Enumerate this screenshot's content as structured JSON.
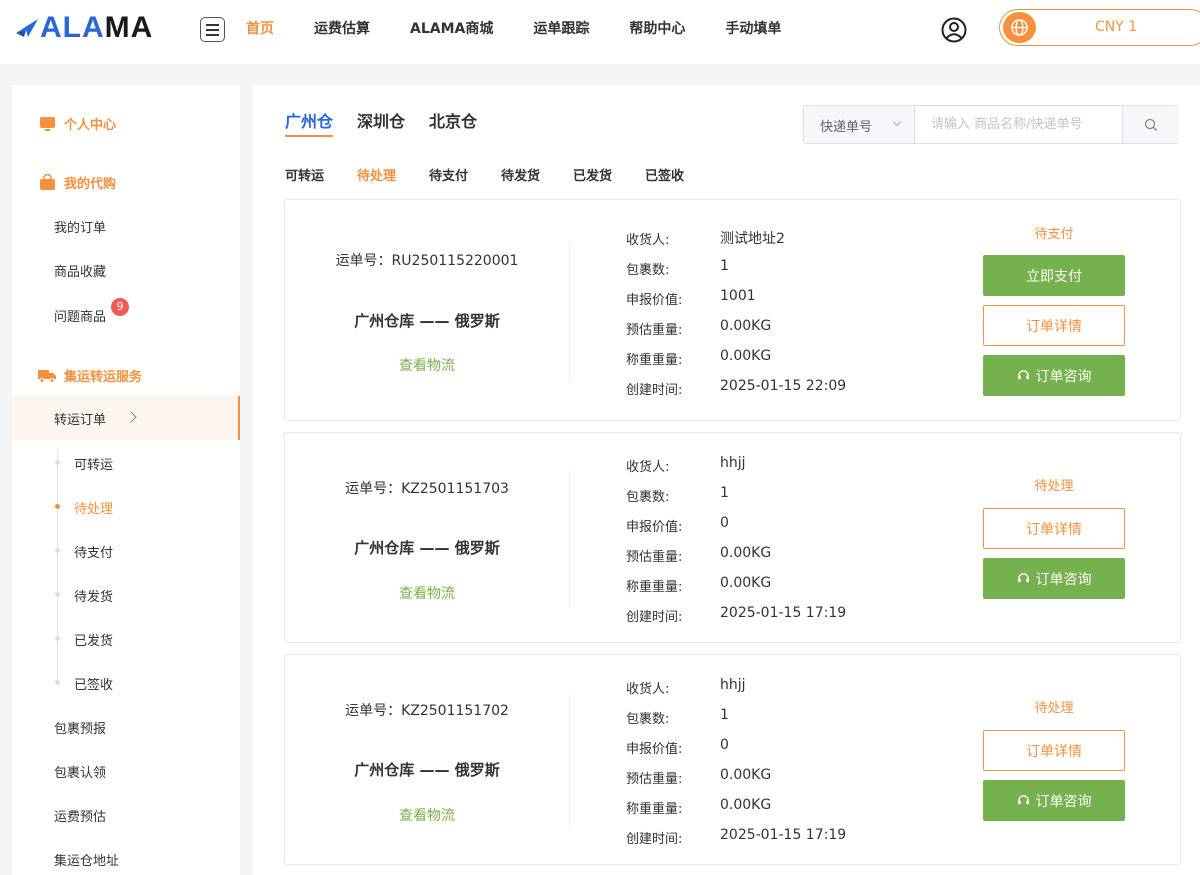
{
  "header": {
    "logo": {
      "blue": "ALA",
      "dark": "MA"
    },
    "nav": [
      {
        "label": "首页",
        "active": true
      },
      {
        "label": "运费估算",
        "active": false
      },
      {
        "label": "ALAMA商城",
        "active": false
      },
      {
        "label": "运单跟踪",
        "active": false
      },
      {
        "label": "帮助中心",
        "active": false
      },
      {
        "label": "手动填单",
        "active": false
      }
    ],
    "currency": "CNY 1"
  },
  "sidebar": {
    "personal": "个人中心",
    "purchase": "我的代购",
    "purchase_items": [
      "我的订单",
      "商品收藏",
      "问题商品"
    ],
    "problem_badge": "9",
    "forwarding": "集运转运服务",
    "transfer_orders": "转运订单",
    "sub_items": [
      {
        "label": "可转运",
        "active": false
      },
      {
        "label": "待处理",
        "active": true
      },
      {
        "label": "待支付",
        "active": false
      },
      {
        "label": "待发货",
        "active": false
      },
      {
        "label": "已发货",
        "active": false
      },
      {
        "label": "已签收",
        "active": false
      }
    ],
    "more_items": [
      "包裹预报",
      "包裹认领",
      "运费预估",
      "集运仓地址"
    ]
  },
  "main": {
    "warehouses": [
      {
        "label": "广州仓",
        "active": true
      },
      {
        "label": "深圳仓",
        "active": false
      },
      {
        "label": "北京仓",
        "active": false
      }
    ],
    "search": {
      "select": "快递单号",
      "placeholder": "请输入 商品名称/快递单号"
    },
    "status_tabs": [
      {
        "label": "可转运",
        "active": false
      },
      {
        "label": "待处理",
        "active": true
      },
      {
        "label": "待支付",
        "active": false
      },
      {
        "label": "待发货",
        "active": false
      },
      {
        "label": "已发货",
        "active": false
      },
      {
        "label": "已签收",
        "active": false
      }
    ],
    "labels": {
      "receiver": "收货人:",
      "packages": "包裹数:",
      "declared": "申报价值:",
      "est_weight": "预估重量:",
      "weighed": "称重重量:",
      "created": "创建时间:",
      "waybill_prefix": "运单号:",
      "track": "查看物流",
      "pay": "立即支付",
      "detail": "订单详情",
      "consult": "订单咨询"
    },
    "orders": [
      {
        "waybill": "运单号：RU250115220001",
        "route": "广州仓库 —— 俄罗斯",
        "receiver": "测试地址2",
        "packages": "1",
        "declared": "1001",
        "est_weight": "0.00KG",
        "weighed": "0.00KG",
        "created": "2025-01-15 22:09",
        "status": "待支付"
      },
      {
        "waybill": "运单号：KZ2501151703",
        "route": "广州仓库 —— 俄罗斯",
        "receiver": "hhjj",
        "packages": "1",
        "declared": "0",
        "est_weight": "0.00KG",
        "weighed": "0.00KG",
        "created": "2025-01-15 17:19",
        "status": "待处理"
      },
      {
        "waybill": "运单号：KZ2501151702",
        "route": "广州仓库 —— 俄罗斯",
        "receiver": "hhjj",
        "packages": "1",
        "declared": "0",
        "est_weight": "0.00KG",
        "weighed": "0.00KG",
        "created": "2025-01-15 17:19",
        "status": "待处理"
      }
    ]
  },
  "colors": {
    "accent": "#f5913e",
    "brand_blue": "#2a66d9",
    "green": "#76b14f",
    "badge": "#f25858"
  }
}
